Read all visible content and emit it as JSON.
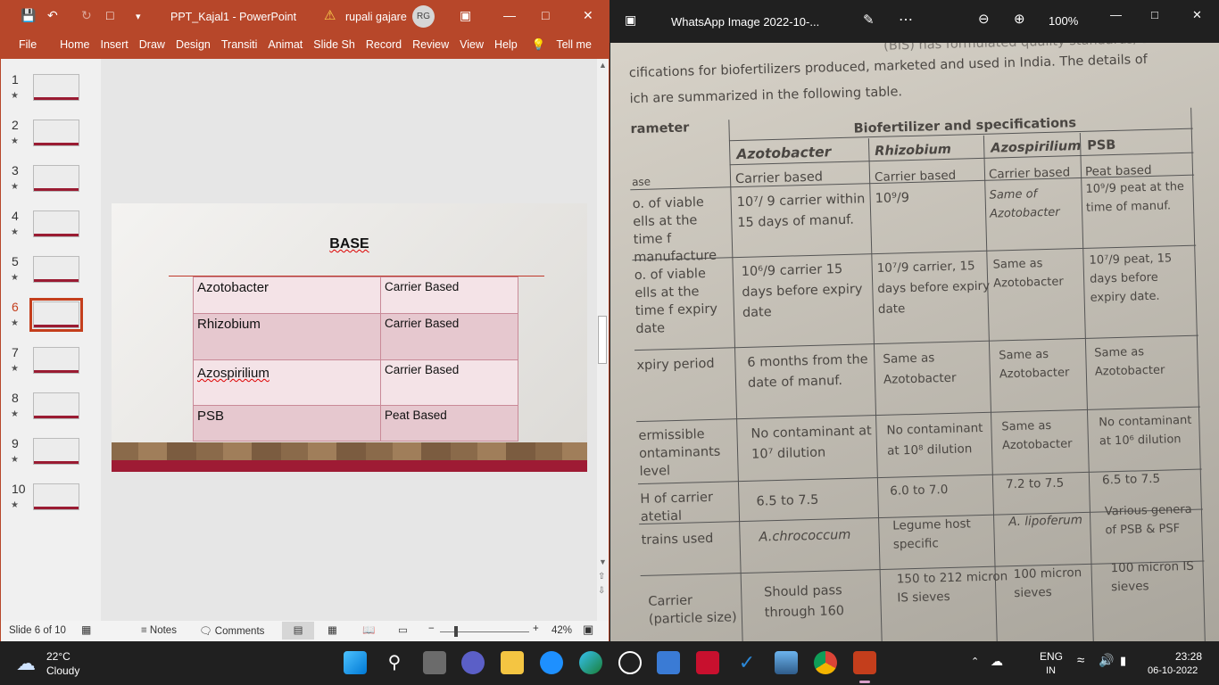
{
  "ppt": {
    "title": "PPT_Kajal1 - PowerPoint",
    "user": "rupali gajare",
    "initials": "RG",
    "menu": [
      "File",
      "Home",
      "Insert",
      "Draw",
      "Design",
      "Transiti",
      "Animat",
      "Slide Sh",
      "Record",
      "Review",
      "View",
      "Help",
      "Tell me"
    ],
    "thumbs": [
      {
        "n": "1"
      },
      {
        "n": "2"
      },
      {
        "n": "3"
      },
      {
        "n": "4"
      },
      {
        "n": "5"
      },
      {
        "n": "6"
      },
      {
        "n": "7"
      },
      {
        "n": "8"
      },
      {
        "n": "9"
      },
      {
        "n": "10"
      }
    ],
    "selected_thumb": "6",
    "slide": {
      "title": "BASE",
      "rows": [
        {
          "organism": "Azotobacter",
          "base": "Carrier Based"
        },
        {
          "organism": "Rhizobium",
          "base": "Carrier Based"
        },
        {
          "organism": "Azospirilium",
          "base": "Carrier Based"
        },
        {
          "organism": "PSB",
          "base": "Peat Based"
        }
      ]
    },
    "status": {
      "slide": "Slide 6 of 10",
      "notes": "Notes",
      "comments": "Comments",
      "zoom": "42%"
    }
  },
  "photos": {
    "title": "WhatsApp Image 2022-10-...",
    "zoom": "100%",
    "text": {
      "line0": "(BIS) has formulated quality standards/ BIS",
      "line1": "cifications for biofertilizers produced, marketed and used in India. The details of",
      "line2": "ich are summarized in the following table.",
      "param": "rameter",
      "bio": "Biofertilizer and specifications",
      "h1": "Azotobacter",
      "h2": "Rhizobium",
      "h3": "Azospirilium",
      "h4": "PSB",
      "r0": "ase",
      "r0a": "Carrier based",
      "r0b": "Carrier based",
      "r0c": "Carrier based",
      "r0d": "Peat based",
      "r1": "o. of viable ells at the time f manufacture",
      "r1a": "10⁷/ 9 carrier within 15 days of manuf.",
      "r1b": "10⁹/9",
      "r1c": "Same of Azotobacter",
      "r1d": "10⁹/9 peat at the time of manuf.",
      "r2": "o. of viable ells at the time f expiry date",
      "r2a": "10⁶/9 carrier 15 days before expiry date",
      "r2b": "10⁷/9 carrier, 15 days before expiry date",
      "r2c": "Same as Azotobacter",
      "r2d": "10⁷/9 peat, 15 days before expiry date.",
      "r3": "xpiry period",
      "r3a": "6 months from the date of manuf.",
      "r3b": "Same as Azotobacter",
      "r3c": "Same as Azotobacter",
      "r3d": "Same as Azotobacter",
      "r4": "ermissible ontaminants level",
      "r4a": "No contaminant at 10⁷ dilution",
      "r4b": "No contaminant at 10⁸ dilution",
      "r4c": "Same as Azotobacter",
      "r4d": "No contaminant at 10⁶ dilution",
      "r5": "H of carrier atetial",
      "r5a": "6.5 to 7.5",
      "r5b": "6.0 to 7.0",
      "r5c": "7.2 to 7.5",
      "r5d": "6.5 to 7.5",
      "r6": "trains used",
      "r6a": "A.chrococcum",
      "r6b": "Legume host specific",
      "r6c": "A. lipoferum",
      "r6d": "Various genera of PSB & PSF",
      "r7": "Carrier (particle size)",
      "r7a": "Should pass through 160",
      "r7b": "150 to 212 micron IS sieves",
      "r7c": "100 micron sieves",
      "r7d": "100 micron IS sieves"
    }
  },
  "taskbar": {
    "temp": "22°C",
    "weather": "Cloudy",
    "lang": "ENG",
    "region": "IN",
    "time": "23:28",
    "date": "06-10-2022"
  }
}
